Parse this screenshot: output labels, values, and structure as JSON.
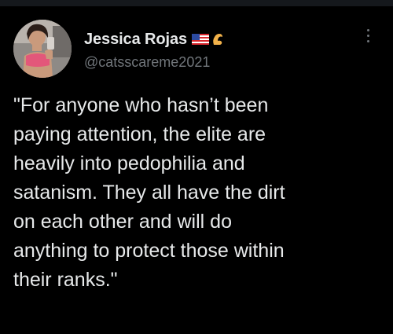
{
  "tweet": {
    "author": {
      "display_name": "Jessica Rojas",
      "handle": "@catsscareme2021",
      "avatar_icon": "profile-photo",
      "badges": [
        "us-flag-icon",
        "flexed-arm-icon"
      ]
    },
    "more_icon": "more-options-icon",
    "text": "\"For anyone who hasn’t been\npaying attention, the elite are\nheavily into pedophilia and\nsatanism. They all have the dirt\non each other and will do\nanything to protect those within\ntheir ranks.\""
  },
  "colors": {
    "background": "#000000",
    "text_primary": "#e7e9ea",
    "text_secondary": "#71767b"
  }
}
